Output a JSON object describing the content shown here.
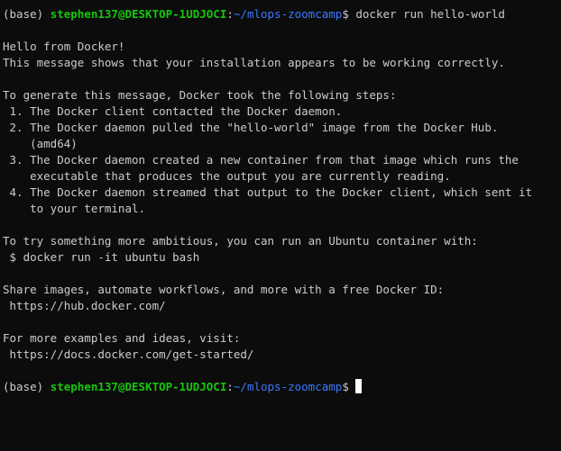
{
  "prompt": {
    "env": "(base) ",
    "user_host": "stephen137@DESKTOP-1UDJOCI",
    "separator": ":",
    "path": "~/mlops-zoomcamp",
    "symbol": "$ "
  },
  "command": "docker run hello-world",
  "output": {
    "hello": "Hello from Docker!",
    "working": "This message shows that your installation appears to be working correctly.",
    "steps_intro": "To generate this message, Docker took the following steps:",
    "step1": " 1. The Docker client contacted the Docker daemon.",
    "step2a": " 2. The Docker daemon pulled the \"hello-world\" image from the Docker Hub.",
    "step2b": "    (amd64)",
    "step3a": " 3. The Docker daemon created a new container from that image which runs the",
    "step3b": "    executable that produces the output you are currently reading.",
    "step4a": " 4. The Docker daemon streamed that output to the Docker client, which sent it",
    "step4b": "    to your terminal.",
    "ambitious": "To try something more ambitious, you can run an Ubuntu container with:",
    "ubuntu_cmd": " $ docker run -it ubuntu bash",
    "share": "Share images, automate workflows, and more with a free Docker ID:",
    "hub_url": " https://hub.docker.com/",
    "examples": "For more examples and ideas, visit:",
    "docs_url": " https://docs.docker.com/get-started/"
  },
  "colors": {
    "background": "#0c0c0c",
    "text": "#cccccc",
    "user_host": "#16c60c",
    "path": "#3b78ff"
  }
}
